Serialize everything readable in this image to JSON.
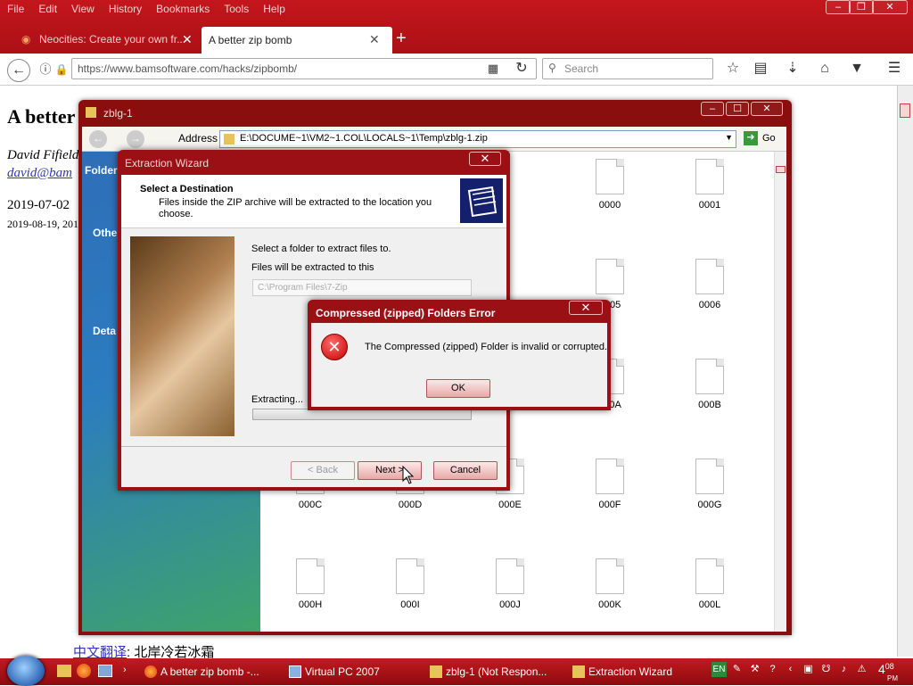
{
  "firefox": {
    "menu": [
      "File",
      "Edit",
      "View",
      "History",
      "Bookmarks",
      "Tools",
      "Help"
    ],
    "tabs": [
      {
        "label": "Neocities: Create your own fr..."
      },
      {
        "label": "A better zip bomb"
      }
    ],
    "url": "https://www.bamsoftware.com/hacks/zipbomb/",
    "search_placeholder": "Search"
  },
  "page": {
    "title": "A better",
    "author": "David Fifield",
    "email": "david@bam",
    "date1": "2019-07-02",
    "date2": "2019-08-19, 201",
    "chinese_link": "中文翻译",
    "chinese_text": ": 北岸冷若冰霜"
  },
  "explorer": {
    "title": "zblg-1",
    "address_label": "Address",
    "address": "E:\\DOCUME~1\\VM2~1.COL\\LOCALS~1\\Temp\\zblg-1.zip",
    "go": "Go",
    "sidebar": {
      "folders": "Folder",
      "other": "Othe",
      "details": "Deta"
    },
    "files": [
      "0000",
      "0001",
      "0005",
      "0006",
      "000A",
      "000B",
      "000C",
      "000D",
      "000E",
      "000F",
      "000G",
      "000H",
      "000I",
      "000J",
      "000K",
      "000L"
    ]
  },
  "wizard": {
    "title": "Extraction Wizard",
    "heading": "Select a Destination",
    "subheading": "Files inside the ZIP archive will be extracted to the location you choose.",
    "line1": "Select a folder to extract files to.",
    "line2": "Files will be extracted to this",
    "path": "C:\\Program Files\\7-Zip",
    "extracting": "Extracting...",
    "back": "< Back",
    "next": "Next >",
    "cancel": "Cancel"
  },
  "error": {
    "title": "Compressed (zipped) Folders Error",
    "message": "The Compressed (zipped) Folder is invalid or corrupted.",
    "ok": "OK"
  },
  "taskbar": {
    "items": [
      {
        "label": "A better zip bomb -..."
      },
      {
        "label": "Virtual PC 2007"
      },
      {
        "label": "zblg-1 (Not Respon..."
      },
      {
        "label": "Extraction Wizard"
      }
    ],
    "lang": "EN",
    "time": "4",
    "time_small": "08",
    "ampm": "PM"
  }
}
